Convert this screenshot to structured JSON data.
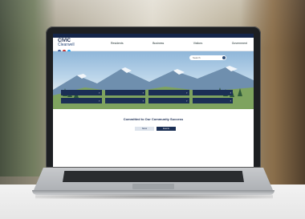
{
  "website": {
    "logo_line1": "CIVIC",
    "logo_line2": "Clearwell",
    "nav": [
      "Residents",
      "Business",
      "Visitors",
      "Government"
    ],
    "search_placeholder": "Search",
    "quick_links": [
      "",
      "",
      "",
      "",
      "",
      "",
      "",
      ""
    ],
    "welcome_title": "Committed to Our Community Success",
    "welcome_subtitle": "",
    "tabs": [
      "News",
      "Events"
    ],
    "news": [
      {
        "heading": "",
        "body": ""
      },
      {
        "heading": "",
        "body": ""
      },
      {
        "heading": "",
        "body": ""
      }
    ]
  },
  "colors": {
    "brand_navy": "#14254a",
    "quicklink_navy": "#1b2f55",
    "laptop_bezel": "#1d1f22",
    "laptop_base": "#c7c9cc"
  },
  "icons": [
    "search-icon",
    "facebook-icon",
    "twitter-icon",
    "youtube-icon"
  ]
}
